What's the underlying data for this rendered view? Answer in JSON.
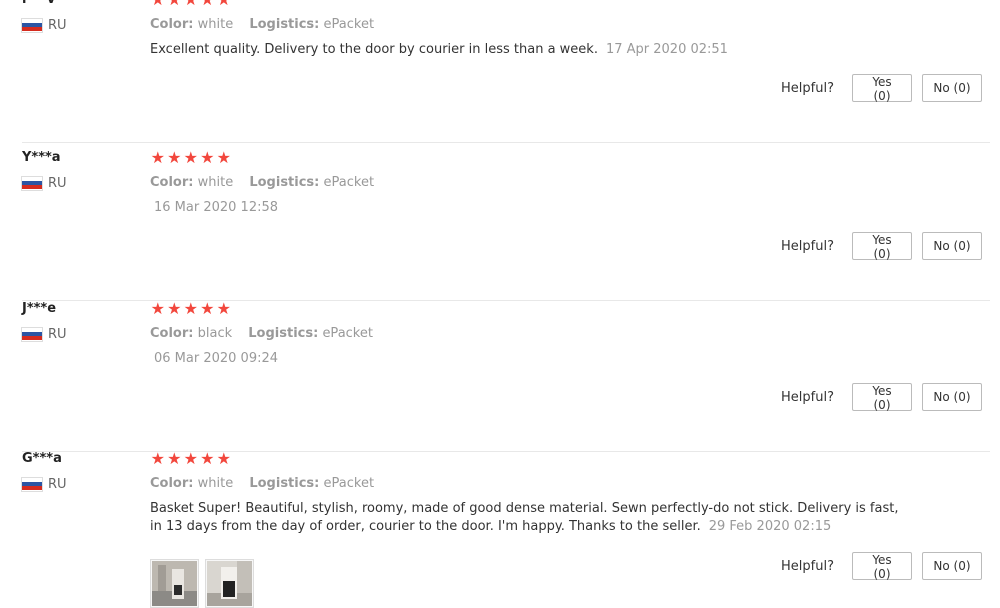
{
  "helpful_label": "Helpful?",
  "attr_labels": {
    "color": "Color:",
    "logistics": "Logistics:"
  },
  "colors": {
    "star": "#f2473d",
    "muted": "#999999",
    "divider": "#e8e8e8"
  },
  "reviews": [
    {
      "user": "l***v",
      "country": "RU",
      "rating": 5,
      "color": "white",
      "logistics": "ePacket",
      "text": "Excellent quality. Delivery to the door by courier in less than a week.",
      "date": "17 Apr 2020 02:51",
      "yes": "Yes (0)",
      "no": "No (0)"
    },
    {
      "user": "Y***a",
      "country": "RU",
      "rating": 5,
      "color": "white",
      "logistics": "ePacket",
      "text": "",
      "date": "16 Mar 2020 12:58",
      "yes": "Yes (0)",
      "no": "No (0)"
    },
    {
      "user": "J***e",
      "country": "RU",
      "rating": 5,
      "color": "black",
      "logistics": "ePacket",
      "text": "",
      "date": "06 Mar 2020 09:24",
      "yes": "Yes (0)",
      "no": "No (0)"
    },
    {
      "user": "G***a",
      "country": "RU",
      "rating": 5,
      "color": "white",
      "logistics": "ePacket",
      "text": "Basket Super! Beautiful, stylish, roomy, made of good dense material. Sewn perfectly-do not stick. Delivery is fast, in 13 days from the day of order, courier to the door. I'm happy. Thanks to the seller.",
      "date": "29 Feb 2020 02:15",
      "yes": "Yes (0)",
      "no": "No (0)",
      "photos": [
        "review-photo-icon",
        "review-photo-icon"
      ]
    }
  ]
}
